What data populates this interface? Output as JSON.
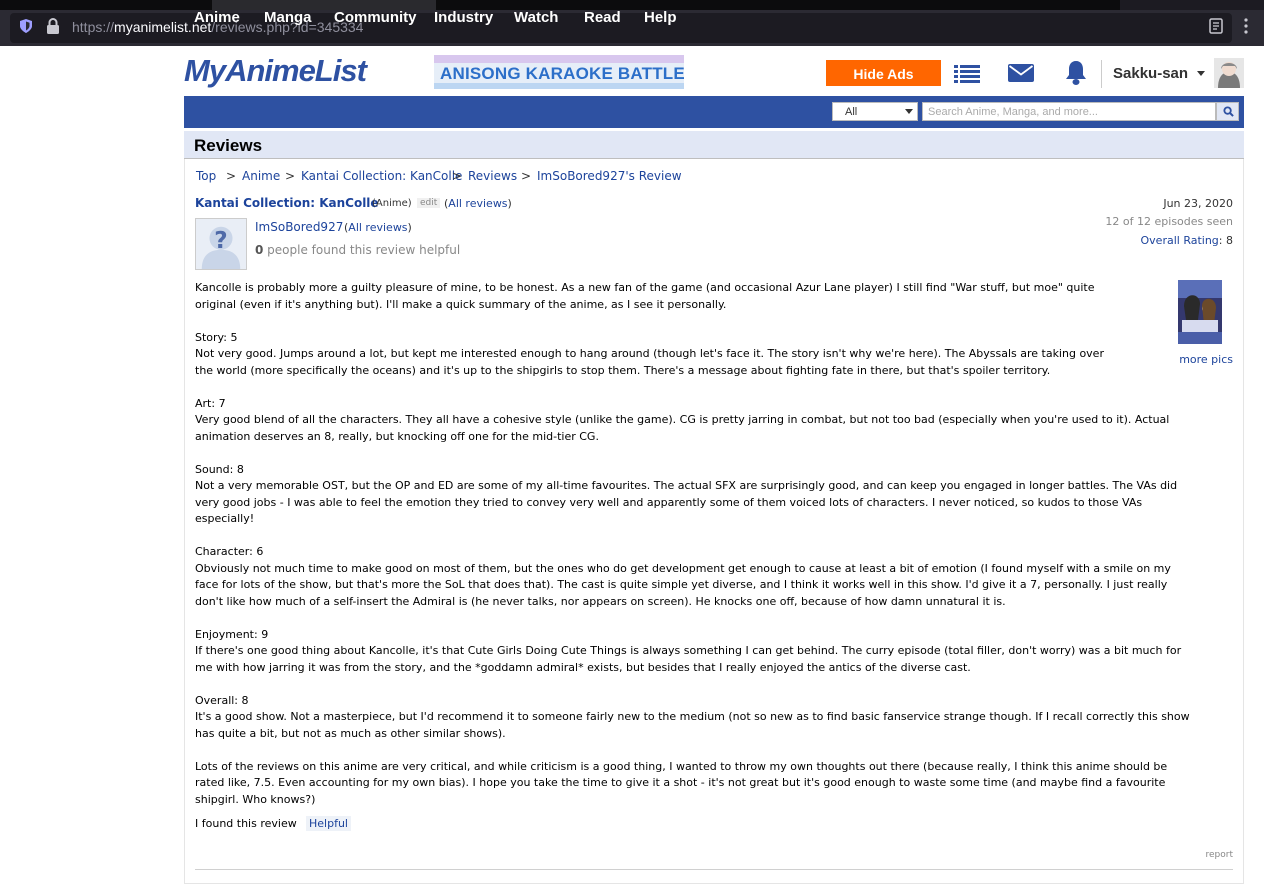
{
  "browser": {
    "url_prefix": "https://",
    "url_host": "myanimelist.net",
    "url_path": "/reviews.php?id=345334"
  },
  "header": {
    "logo": "MyAnimeList",
    "banner_text": "ANISONG KARAOKE BATTLE",
    "hide_ads_label": "Hide Ads",
    "username": "Sakku-san"
  },
  "nav": {
    "items": [
      "Anime",
      "Manga",
      "Community",
      "Industry",
      "Watch",
      "Read",
      "Help"
    ],
    "search_select": "All",
    "search_placeholder": "Search Anime, Manga, and more..."
  },
  "page": {
    "title": "Reviews",
    "breadcrumb": [
      "Top",
      "Anime",
      "Kantai Collection: KanColle",
      "Reviews",
      "ImSoBored927's Review"
    ]
  },
  "review": {
    "anime_title": "Kantai Collection: KanColle",
    "anime_type": "(Anime)",
    "edit": "edit",
    "all_reviews_open": "(",
    "all_reviews_label": "All reviews",
    "all_reviews_close": ")",
    "date": "Jun 23, 2020",
    "episodes_seen": "12 of 12 episodes seen",
    "overall_rating_label": "Overall Rating",
    "overall_rating_value": ": 8",
    "reviewer": "ImSoBored927",
    "helpful_count": "0",
    "helpful_text": " people found this review helpful",
    "more_pics": "more pics",
    "paragraphs": [
      [
        "Kancolle is probably more a guilty pleasure of mine, to be honest. As a new fan of the game (and occasional Azur Lane player) I still find \"War stuff, but moe\" quite",
        "original (even if it's anything but). I'll make a quick summary of the anime, as I see it personally."
      ],
      [
        "Story: 5",
        "Not very good. Jumps around a lot, but kept me interested enough to hang around (though let's face it. The story isn't why we're here). The Abyssals are taking over",
        "the world (more specifically the oceans) and it's up to the shipgirls to stop them. There's a message about fighting fate in there, but that's spoiler territory."
      ],
      [
        "Art: 7",
        "Very good blend of all the characters. They all have a cohesive style (unlike the game). CG is pretty jarring in combat, but not too bad (especially when you're used to it). Actual",
        "animation deserves an 8, really, but knocking off one for the mid-tier CG."
      ],
      [
        "Sound: 8",
        "Not a very memorable OST, but the OP and ED are some of my all-time favourites. The actual SFX are surprisingly good, and can keep you engaged in longer battles. The VAs did",
        "very good jobs - I was able to feel the emotion they tried to convey very well and apparently some of them voiced lots of characters. I never noticed, so kudos to those VAs",
        "especially!"
      ],
      [
        "Character: 6",
        "Obviously not much time to make good on most of them, but the ones who do get development get enough to cause at least a bit of emotion (I found myself with a smile on my",
        "face for lots of the show, but that's more the SoL that does that). The cast is quite simple yet diverse, and I think it works well in this show. I'd give it a 7, personally. I just really",
        "don't like how much of a self-insert the Admiral is (he never talks, nor appears on screen). He knocks one off, because of how damn unnatural it is."
      ],
      [
        "Enjoyment: 9",
        "If there's one good thing about Kancolle, it's that Cute Girls Doing Cute Things is always something I can get behind. The curry episode (total filler, don't worry) was a bit much for",
        "me with how jarring it was from the story, and the *goddamn admiral* exists, but besides that I really enjoyed the antics of the diverse cast."
      ],
      [
        "Overall: 8",
        "It's a good show. Not a masterpiece, but I'd recommend it to someone fairly new to the medium (not so new as to find basic fanservice strange though. If I recall correctly this show",
        "has quite a bit, but not as much as other similar shows)."
      ],
      [
        "Lots of the reviews on this anime are very critical, and while criticism is a good thing, I wanted to throw my own thoughts out there (because really, I think this anime should be",
        "rated like, 7.5. Even accounting for my own bias). I hope you take the time to give it a shot - it's not great but it's good enough to waste some time (and maybe find a favourite",
        "shipgirl. Who knows?)"
      ]
    ],
    "found_label": "I found this review",
    "helpful_button": "Helpful",
    "report": "report"
  },
  "colors": {
    "brand_blue": "#2e51a2",
    "link_blue": "#1c439b",
    "hide_ads_orange": "#ff6600",
    "header_bg": "#e1e7f5"
  }
}
